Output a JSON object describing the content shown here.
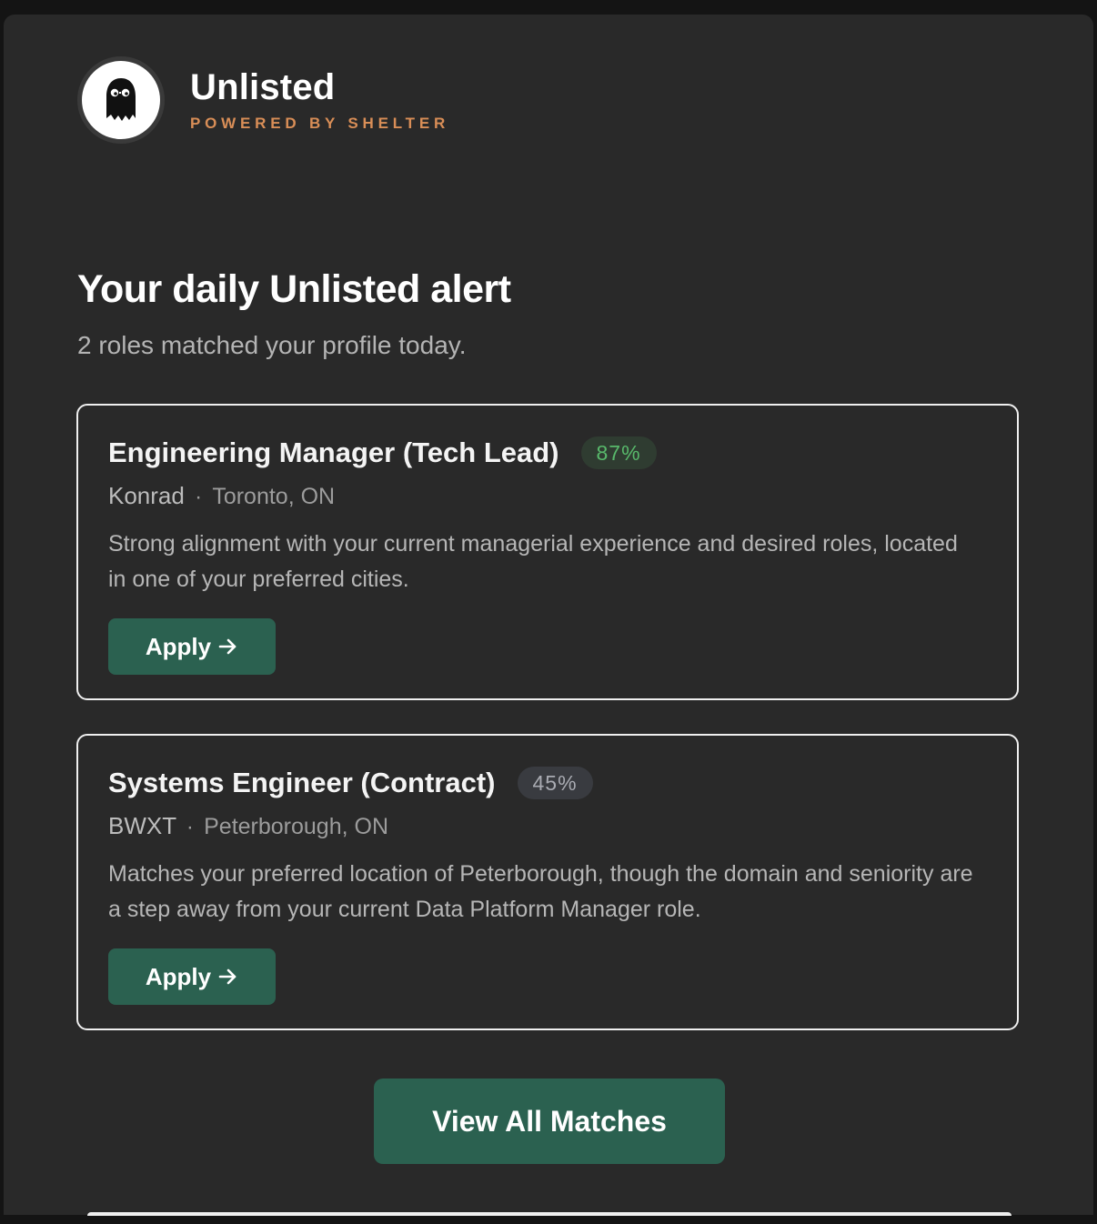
{
  "brand": {
    "name": "Unlisted",
    "tagline": "POWERED BY SHELTER",
    "accent_color": "#d98e57",
    "logo_icon": "ghost-with-glasses-icon"
  },
  "header": {
    "title": "Your daily Unlisted alert",
    "subtitle": "2 roles matched your profile today."
  },
  "matches": [
    {
      "title": "Engineering Manager (Tech Lead)",
      "score": "87%",
      "score_color": "#58b96b",
      "company": "Konrad",
      "separator": "·",
      "location": "Toronto, ON",
      "description": "Strong alignment with your current managerial experience and desired roles, located in one of your preferred cities.",
      "apply_label": "Apply",
      "apply_icon": "arrow-right-icon"
    },
    {
      "title": "Systems Engineer (Contract)",
      "score": "45%",
      "score_color": "#a9abb2",
      "company": "BWXT",
      "separator": "·",
      "location": "Peterborough, ON",
      "description": "Matches your preferred location of Peterborough, though the domain and seniority are a step away from your current Data Platform Manager role.",
      "apply_label": "Apply",
      "apply_icon": "arrow-right-icon"
    }
  ],
  "cta": {
    "view_all_label": "View All Matches",
    "button_color": "#2b6150"
  }
}
